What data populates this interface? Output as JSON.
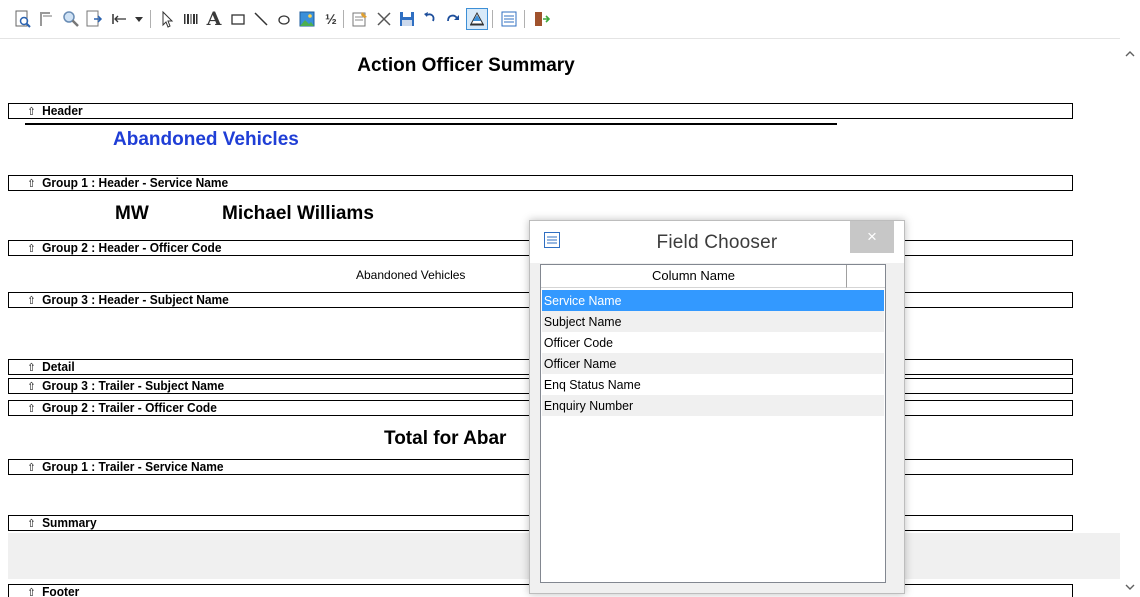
{
  "toolbar": {
    "buttons": [
      {
        "name": "print-preview-icon"
      },
      {
        "name": "page-setup-icon"
      },
      {
        "name": "zoom-icon"
      },
      {
        "name": "export-icon"
      },
      {
        "name": "first-page-icon"
      },
      {
        "name": "dropdown-arrow-icon"
      },
      {
        "name": "pointer-icon"
      },
      {
        "name": "barcode-icon"
      },
      {
        "name": "text-icon"
      },
      {
        "name": "rectangle-icon"
      },
      {
        "name": "line-icon"
      },
      {
        "name": "ellipse-icon"
      },
      {
        "name": "image-icon"
      },
      {
        "name": "formula-icon"
      },
      {
        "name": "properties-icon"
      },
      {
        "name": "delete-icon"
      },
      {
        "name": "save-icon"
      },
      {
        "name": "undo-icon"
      },
      {
        "name": "redo-icon"
      },
      {
        "name": "field-chooser-icon"
      },
      {
        "name": "band-list-icon"
      },
      {
        "name": "exit-icon"
      }
    ]
  },
  "report": {
    "title": "Action Officer Summary",
    "bands": {
      "header": "Header",
      "group1_header": "Group 1 : Header - Service Name",
      "group2_header": "Group 2 : Header - Officer Code",
      "group3_header": "Group 3 : Header - Subject Name",
      "detail": "Detail",
      "group3_trailer": "Group 3 : Trailer - Subject Name",
      "group2_trailer": "Group 2 : Trailer - Officer Code",
      "group1_trailer": "Group 1 : Trailer - Service Name",
      "summary": "Summary",
      "footer": "Footer"
    },
    "header_service": "Abandoned Vehicles",
    "officer_code": "MW",
    "officer_name": "Michael Williams",
    "subject_name": "Abandoned Vehicles",
    "total_label": "Total for Abar"
  },
  "field_chooser": {
    "title": "Field Chooser",
    "close_label": "×",
    "column_header": "Column Name",
    "items": [
      "Service Name",
      "Subject Name",
      "Officer Code",
      "Officer Name",
      "Enq Status Name",
      "Enquiry Number"
    ],
    "selected": "Service Name"
  },
  "colors": {
    "accent_blue": "#1f3ed6",
    "selection": "#3399ff"
  }
}
